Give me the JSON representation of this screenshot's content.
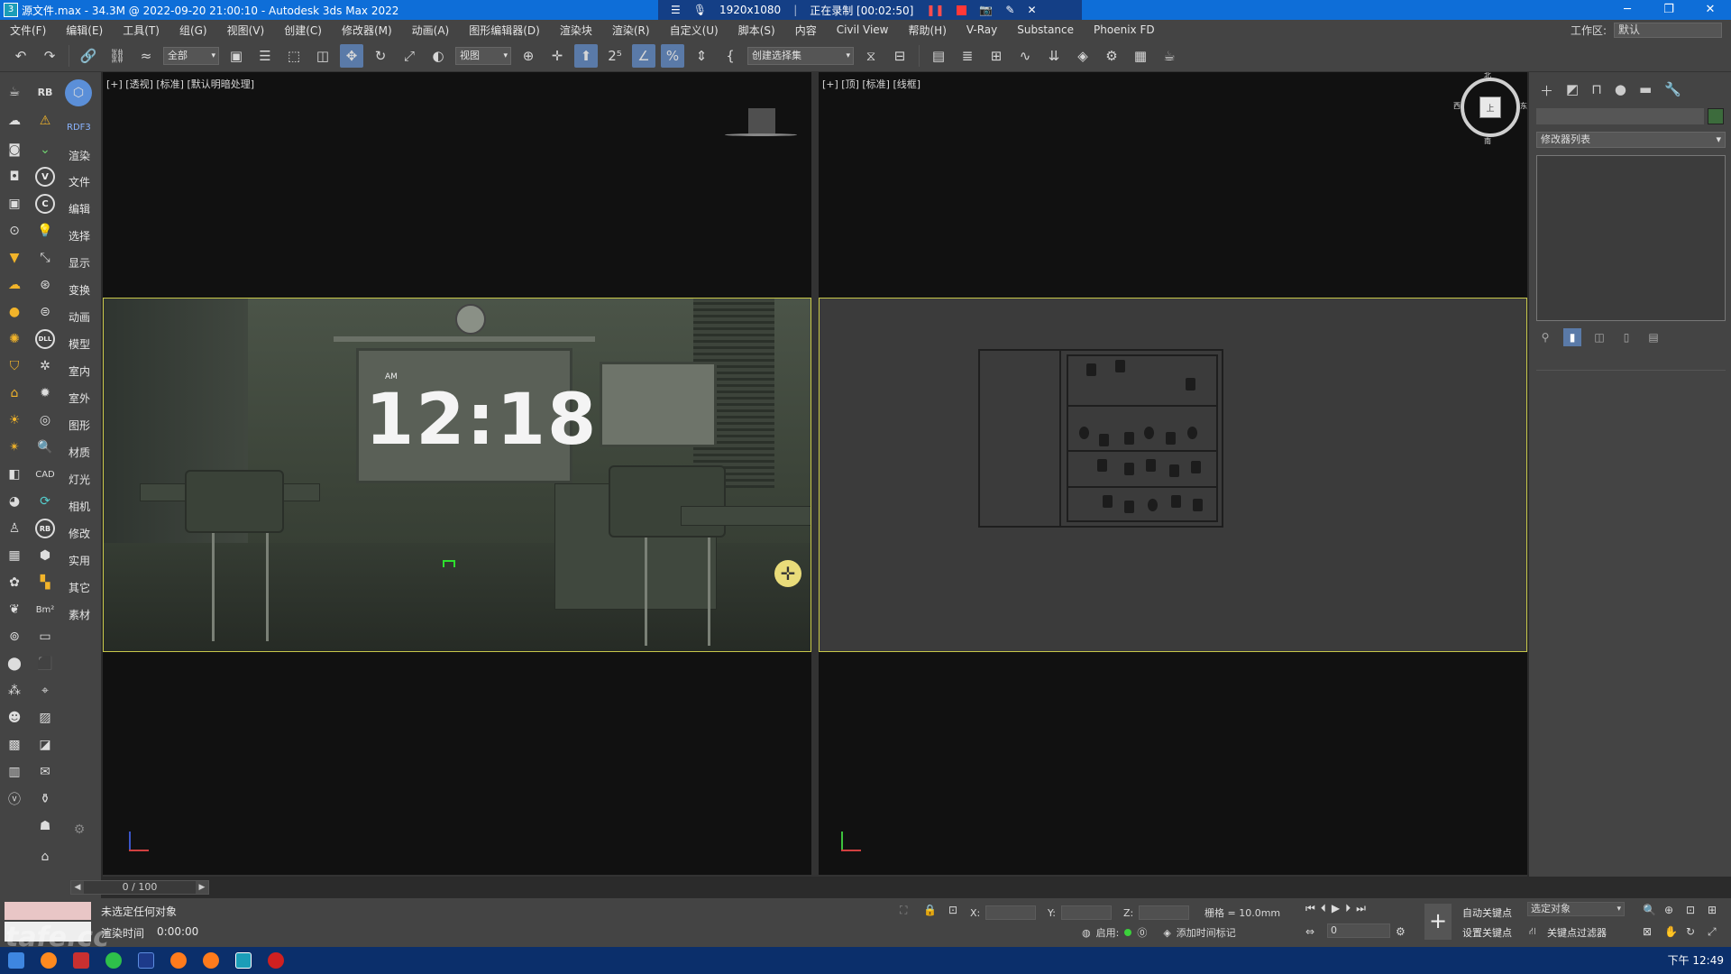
{
  "titlebar": {
    "title": "源文件.max - 34.3M @ 2022-09-20 21:00:10 - Autodesk 3ds Max 2022",
    "app_icon": "3"
  },
  "recorder": {
    "resolution": "1920x1080",
    "status": "正在录制 [00:02:50]"
  },
  "menu": [
    "文件(F)",
    "编辑(E)",
    "工具(T)",
    "组(G)",
    "视图(V)",
    "创建(C)",
    "修改器(M)",
    "动画(A)",
    "图形编辑器(D)",
    "渲染块",
    "渲染(R)",
    "自定义(U)",
    "脚本(S)",
    "内容",
    "Civil View",
    "帮助(H)",
    "V-Ray",
    "Substance",
    "Phoenix FD"
  ],
  "workspace": {
    "label": "工作区:",
    "value": "默认"
  },
  "toolbar": {
    "filter_dd": "全部",
    "refcoord_dd": "视图",
    "selection_set_dd": "创建选择集"
  },
  "left_panel": {
    "top_labels": [
      "RB",
      "RDF3"
    ],
    "categories": [
      "渲染",
      "文件",
      "编辑",
      "选择",
      "显示",
      "变换",
      "动画",
      "模型",
      "室内",
      "室外",
      "图形",
      "材质",
      "灯光",
      "相机",
      "修改",
      "实用",
      "其它",
      "素材"
    ],
    "circle_letters": [
      "V",
      "C",
      "DLL",
      "RB"
    ]
  },
  "viewports": {
    "perspective_label": "[+] [透视] [标准] [默认明暗处理]",
    "top_label": "[+] [顶] [标准] [线框]",
    "board_time": "12:18",
    "board_ampm": "AM",
    "viewcube_face": "上",
    "viewcube_north": "北",
    "viewcube_south": "南",
    "viewcube_west": "西",
    "viewcube_east": "东"
  },
  "right_panel": {
    "modifier_list": "修改器列表"
  },
  "timeslider": {
    "value": "0 / 100"
  },
  "status": {
    "message": "未选定任何对象",
    "render_time_label": "渲染时间",
    "render_time_value": "0:00:00",
    "x_label": "X:",
    "y_label": "Y:",
    "z_label": "Z:",
    "grid": "栅格 = 10.0mm",
    "enable_label": "启用:",
    "add_time_tag": "添加时间标记",
    "auto_key": "自动关键点",
    "set_key": "设置关键点",
    "selected_dd": "选定对象",
    "key_filters": "关键点过滤器",
    "frame": "0"
  },
  "taskbar": {
    "clock": "下午 12:49"
  },
  "watermark": "tafe.cc"
}
